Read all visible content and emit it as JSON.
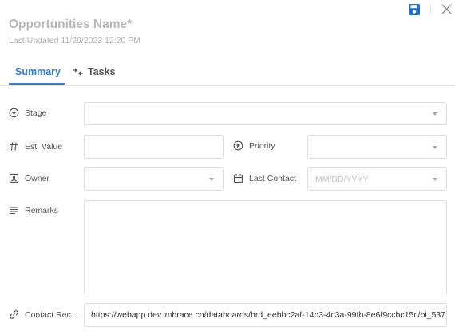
{
  "header": {
    "title": "Opportunities Name*",
    "last_updated": "Last Updated 11/29/2023 12:20 PM"
  },
  "tabs": [
    {
      "label": "Summary",
      "active": true
    },
    {
      "label": "Tasks",
      "active": false
    }
  ],
  "fields": {
    "stage": {
      "label": "Stage",
      "value": ""
    },
    "est_value": {
      "label": "Est. Value",
      "value": ""
    },
    "priority": {
      "label": "Priority",
      "value": ""
    },
    "owner": {
      "label": "Owner",
      "value": ""
    },
    "last_contact": {
      "label": "Last Contact",
      "placeholder": "MM/DD/YYYY"
    },
    "remarks": {
      "label": "Remarks",
      "value": ""
    },
    "contact_record": {
      "label": "Contact Rec...",
      "value": "https://webapp.dev.imbrace.co/databoards/brd_eebbc2af-14b3-4c3a-99fb-8e6f9ccbc15c/bi_537"
    }
  },
  "colors": {
    "accent": "#2f7fe0",
    "title": "#b7b7b7",
    "border": "#dcdcdc"
  },
  "icons": [
    "save-icon",
    "close-icon",
    "tasks-icon",
    "stage-icon",
    "hash-icon",
    "star-circle-icon",
    "owner-badge-icon",
    "calendar-icon",
    "lines-icon",
    "link-icon"
  ]
}
